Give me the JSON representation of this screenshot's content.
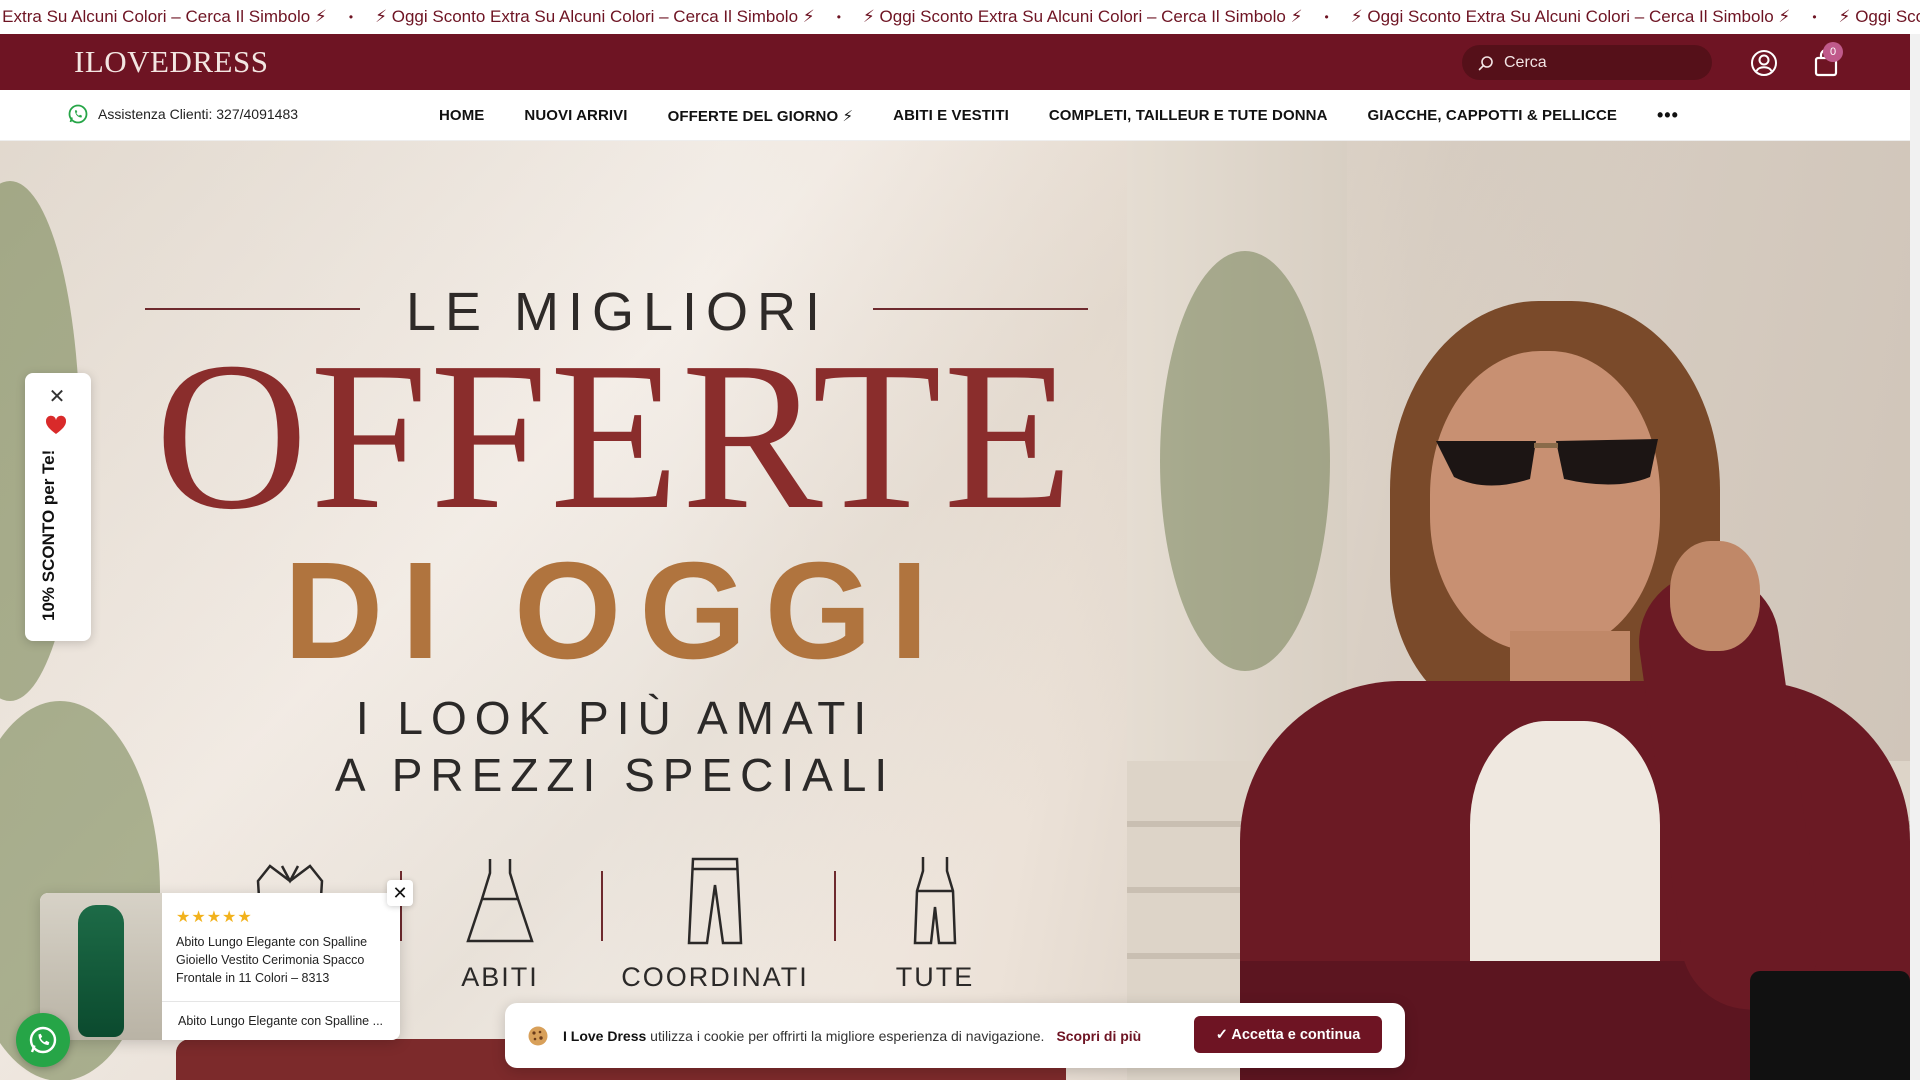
{
  "announcement": {
    "prefix": "o Extra Su Alcuni Colori – Cerca Il Simbolo ⚡",
    "message": "⚡ Oggi Sconto Extra Su Alcuni Colori – Cerca Il Simbolo ⚡",
    "suffix": "⚡ Oggi Sconto Extr",
    "separator": "•"
  },
  "header": {
    "logo": "ILOVEDRESS",
    "search_placeholder": "Cerca",
    "cart_count": "0",
    "icons": [
      "search-icon",
      "account-icon",
      "cart-icon"
    ]
  },
  "support": {
    "label": "Assistenza Clienti: 327/4091483",
    "icon": "whatsapp-icon"
  },
  "nav": {
    "items": [
      {
        "label": "HOME"
      },
      {
        "label": "NUOVI ARRIVI"
      },
      {
        "label": "OFFERTE DEL GIORNO ⚡"
      },
      {
        "label": "ABITI E VESTITI"
      },
      {
        "label": "COMPLETI, TAILLEUR E TUTE DONNA"
      },
      {
        "label": "GIACCHE, CAPPOTTI & PELLICCE"
      }
    ],
    "more": "•••"
  },
  "hero": {
    "kicker": "LE MIGLIORI",
    "title_1": "OFFERTE",
    "title_2": "DI OGGI",
    "subtitle_1": "I LOOK PIÙ AMATI",
    "subtitle_2": "A PREZZI SPECIALI",
    "categories": [
      {
        "label": "",
        "icon": "blazer-icon"
      },
      {
        "label": "ABITI",
        "icon": "dress-icon"
      },
      {
        "label": "COORDINATI",
        "icon": "trousers-icon"
      },
      {
        "label": "TUTE",
        "icon": "jumpsuit-icon"
      }
    ]
  },
  "side_tab": {
    "label": "10% SCONTO per Te!",
    "close": "✕"
  },
  "popup": {
    "stars": "★★★★★",
    "title": "Abito Lungo Elegante con Spalline Gioiello Vestito Cerimonia Spacco Frontale in 11 Colori – 8313",
    "footer": "Abito Lungo Elegante con Spalline ...",
    "close": "✕"
  },
  "cookie": {
    "brand": "I Love Dress",
    "text": " utilizza i cookie per offrirti la migliore esperienza di navigazione.",
    "more": "Scopri di più",
    "accept": "✓ Accetta e continua"
  },
  "colors": {
    "brand": "#6e1423",
    "title_red": "#8a2d2c",
    "title_gold": "#b0743e",
    "whatsapp": "#26a547",
    "badge": "#c05a8b"
  }
}
